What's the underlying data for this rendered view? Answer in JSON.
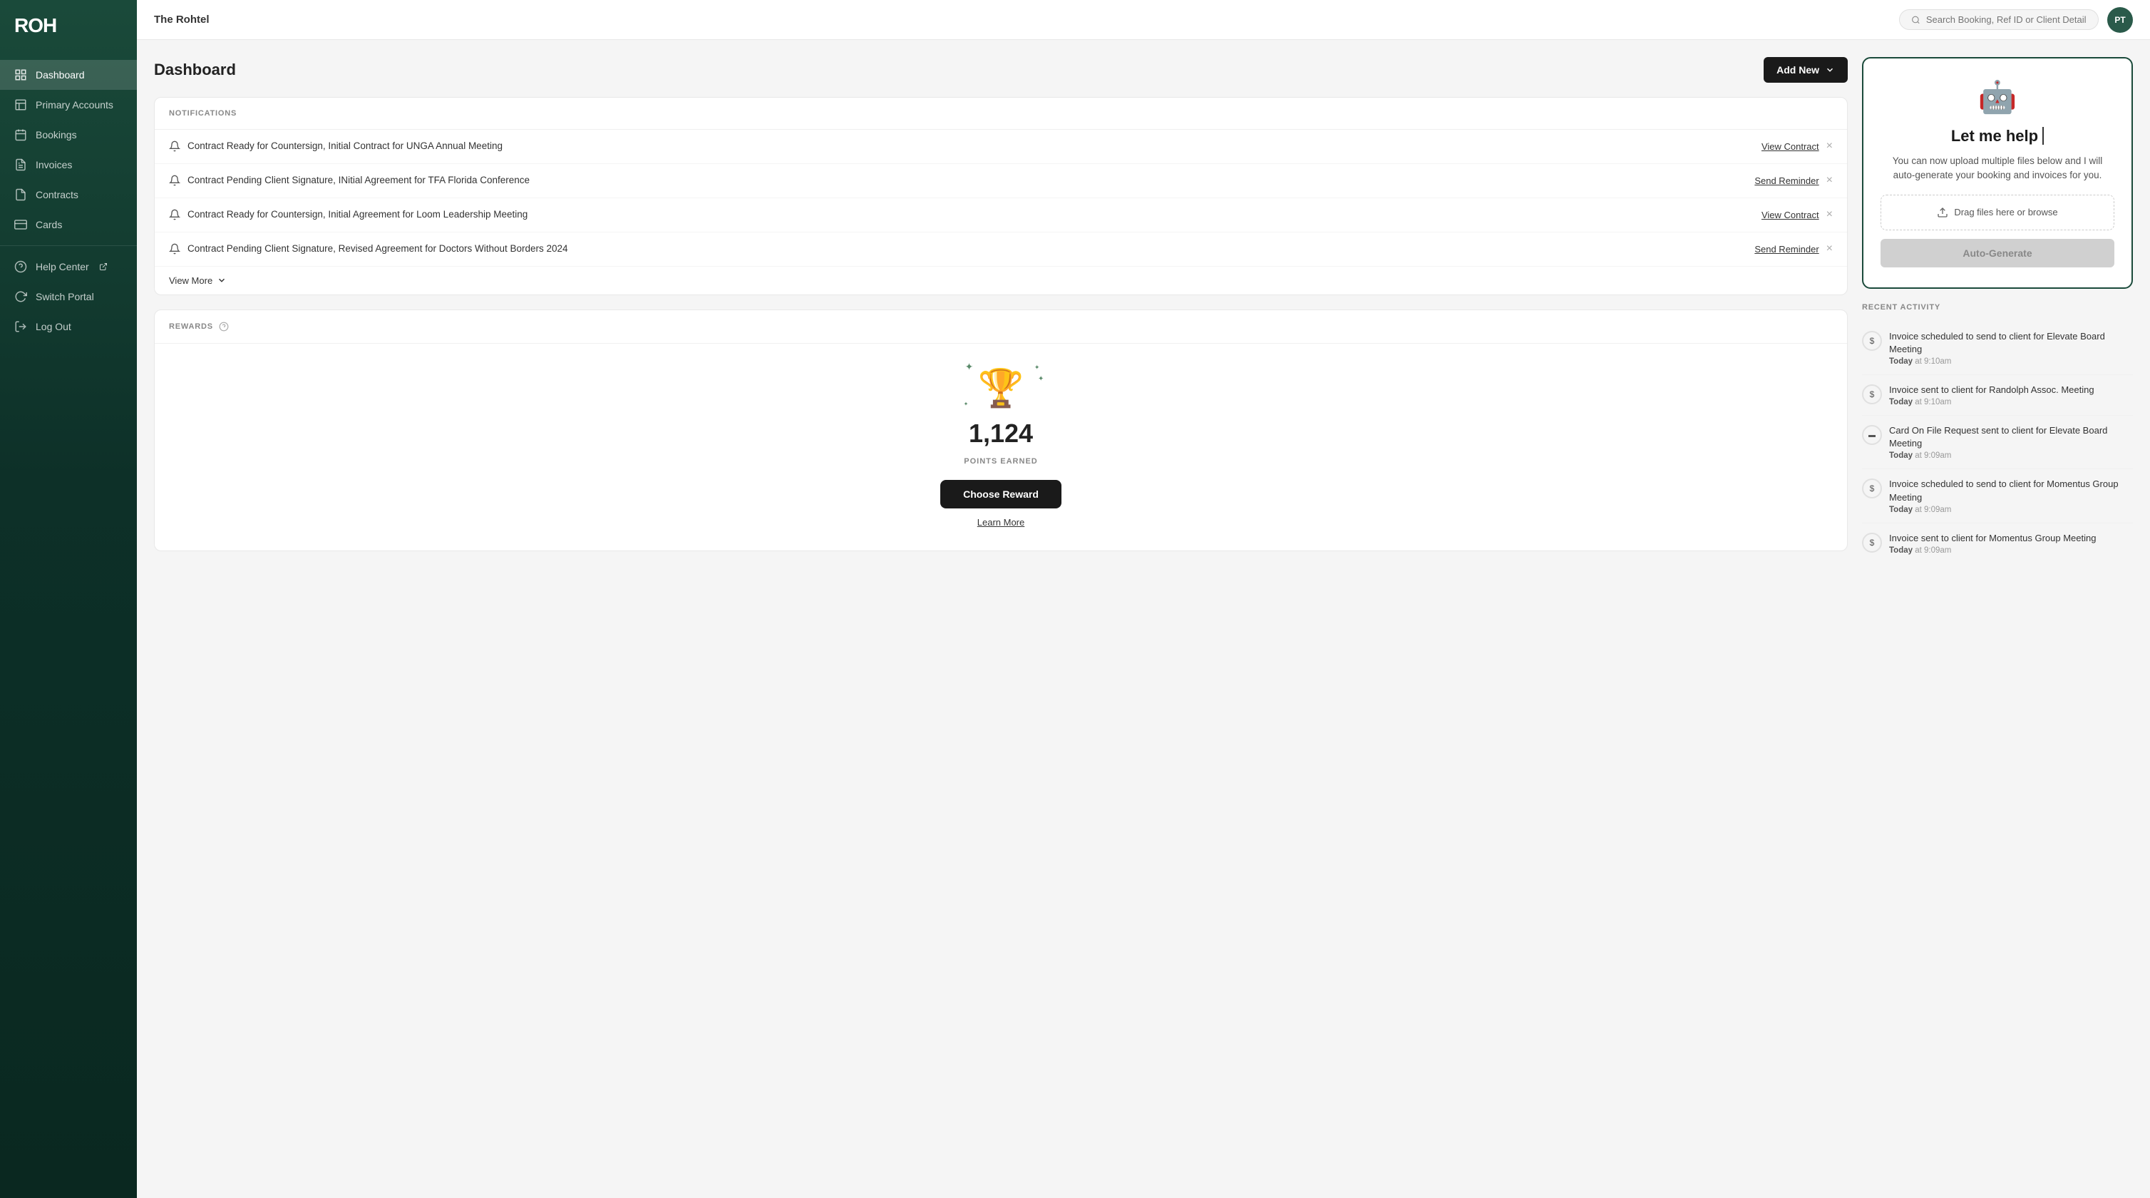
{
  "sidebar": {
    "logo": "ROH",
    "venue": "The Rohtel",
    "items": [
      {
        "id": "dashboard",
        "label": "Dashboard",
        "icon": "grid",
        "active": true
      },
      {
        "id": "primary-accounts",
        "label": "Primary Accounts",
        "icon": "building",
        "active": false
      },
      {
        "id": "bookings",
        "label": "Bookings",
        "icon": "calendar",
        "active": false
      },
      {
        "id": "invoices",
        "label": "Invoices",
        "icon": "file-text",
        "active": false
      },
      {
        "id": "contracts",
        "label": "Contracts",
        "icon": "file",
        "active": false
      },
      {
        "id": "cards",
        "label": "Cards",
        "icon": "credit-card",
        "active": false
      }
    ],
    "bottom_items": [
      {
        "id": "help-center",
        "label": "Help Center",
        "icon": "help-circle"
      },
      {
        "id": "switch-portal",
        "label": "Switch Portal",
        "icon": "refresh-cw"
      },
      {
        "id": "log-out",
        "label": "Log Out",
        "icon": "log-out"
      }
    ]
  },
  "header": {
    "search_placeholder": "Search Booking, Ref ID or Client Details",
    "avatar_initials": "PT"
  },
  "page": {
    "title": "Dashboard",
    "add_new_label": "Add New"
  },
  "notifications": {
    "section_title": "NOTIFICATIONS",
    "items": [
      {
        "text": "Contract Ready for Countersign, Initial Contract for UNGA Annual Meeting",
        "action_label": "View Contract",
        "action_type": "view_contract"
      },
      {
        "text": "Contract Pending Client Signature, INitial Agreement for TFA Florida Conference",
        "action_label": "Send Reminder",
        "action_type": "send_reminder"
      },
      {
        "text": "Contract Ready for Countersign, Initial Agreement for Loom Leadership Meeting",
        "action_label": "View Contract",
        "action_type": "view_contract"
      },
      {
        "text": "Contract Pending Client Signature, Revised Agreement for Doctors Without Borders 2024",
        "action_label": "Send Reminder",
        "action_type": "send_reminder"
      }
    ],
    "view_more_label": "View More"
  },
  "rewards": {
    "section_title": "REWARDS",
    "points_number": "1,124",
    "points_label": "POINTS EARNED",
    "choose_reward_label": "Choose Reward",
    "learn_more_label": "Learn More"
  },
  "ai_assistant": {
    "title": "Let me help",
    "description": "You can now upload multiple files below and I will auto-generate your booking and invoices for you.",
    "upload_label": "Drag files here or browse",
    "generate_label": "Auto-Generate"
  },
  "recent_activity": {
    "section_title": "RECENT ACTIVITY",
    "items": [
      {
        "type": "invoice",
        "description": "Invoice scheduled to send to client for Elevate Board Meeting",
        "time_label": "Today at 9:10am"
      },
      {
        "type": "invoice",
        "description": "Invoice sent to client for Randolph Assoc. Meeting",
        "time_label": "Today at 9:10am"
      },
      {
        "type": "card",
        "description": "Card On File Request sent to client for Elevate Board Meeting",
        "time_label": "Today at 9:09am"
      },
      {
        "type": "invoice",
        "description": "Invoice scheduled to send to client for Momentus Group Meeting",
        "time_label": "Today at 9:09am"
      },
      {
        "type": "invoice",
        "description": "Invoice sent to client for Momentus Group Meeting",
        "time_label": "Today at 9:09am"
      }
    ]
  }
}
